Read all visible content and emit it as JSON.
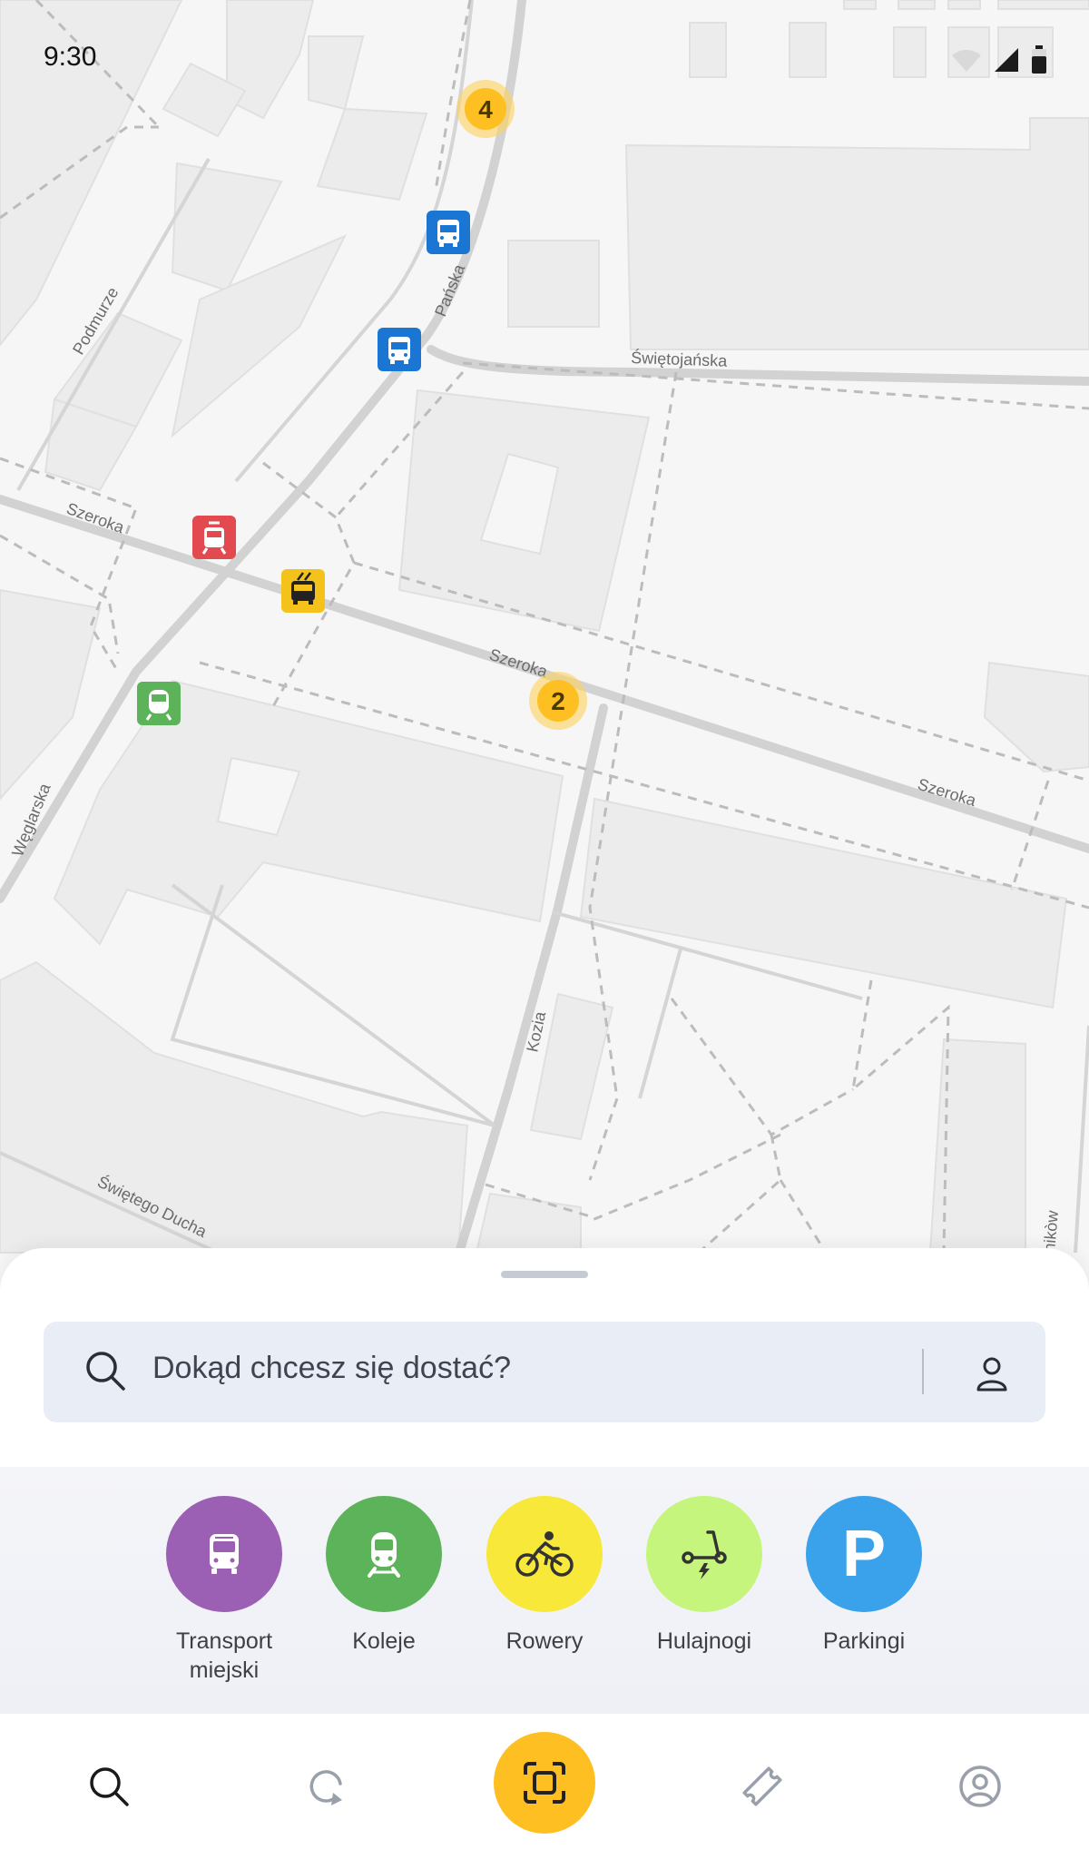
{
  "status_bar": {
    "time": "9:30"
  },
  "map": {
    "streets": [
      "Podmurze",
      "Pańska",
      "Świętojańska",
      "Szeroka",
      "Szeroka",
      "Szeroka",
      "Węglarska",
      "Kozia",
      "Świętego Ducha",
      "nikòw"
    ],
    "clusters": [
      "4",
      "2"
    ]
  },
  "search": {
    "placeholder": "Dokąd chcesz się dostać?"
  },
  "modes": [
    {
      "label": "Transport\nmiejski",
      "color": "#9b5fb4",
      "icon": "bus-icon"
    },
    {
      "label": "Koleje",
      "color": "#5cb35a",
      "icon": "train-icon"
    },
    {
      "label": "Rowery",
      "color": "#f7e83a",
      "icon": "bike-icon"
    },
    {
      "label": "Hulajnogi",
      "color": "#c5f57d",
      "icon": "scooter-icon"
    },
    {
      "label": "Parkingi",
      "color": "#3aa2ea",
      "icon": "parking-icon"
    }
  ],
  "parking_letter": "P",
  "colors": {
    "accent": "#fdbf22",
    "bus_stop": "#1a76d2",
    "tram_stop": "#e34a4f",
    "trolley_stop": "#f5c21b",
    "train_stop": "#5cb35a"
  },
  "navbar": [
    "search-icon",
    "history-icon",
    "scan-icon",
    "ticket-icon",
    "profile-icon"
  ]
}
